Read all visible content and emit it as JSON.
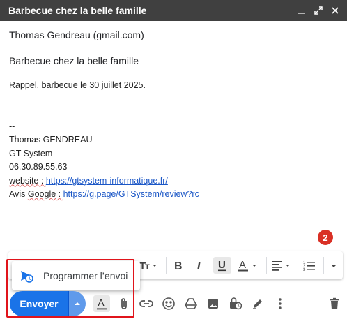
{
  "window": {
    "title": "Barbecue chez la belle famille",
    "controls": [
      "minimize-icon",
      "expand-icon",
      "close-icon"
    ]
  },
  "compose": {
    "to": "Thomas Gendreau (gmail.com)",
    "subject": "Barbecue chez la belle famille",
    "body": {
      "line1": "Rappel, barbecue le 30 juillet 2025.",
      "sig_dash": "--",
      "sig_name": "Thomas GENDREAU",
      "sig_company": "GT System",
      "sig_phone": "06.30.89.55.63",
      "website_label": "website",
      "website_colon": " : ",
      "website_url": "https://gtsystem-informatique.fr/",
      "avis_prefix": "Avis ",
      "google_label": "Google",
      "avis_colon": " : ",
      "review_url": "https://g.page/GTSystem/review?rc"
    }
  },
  "annotation": {
    "badge": "2",
    "highlight_color": "#e0141b"
  },
  "schedule_menu": {
    "label": "Programmer l’envoi",
    "icon": "schedule-send-icon"
  },
  "send": {
    "label": "Envoyer",
    "color": "#1a73e8"
  },
  "format_toolbar": [
    "text-size-icon",
    "bold-icon",
    "italic-icon",
    "underline-icon",
    "text-color-icon",
    "align-icon",
    "list-icon",
    "more-formatting-icon"
  ],
  "bottom_toolbar": [
    "formatting-toggle-icon",
    "attach-icon",
    "link-icon",
    "emoji-icon",
    "drive-icon",
    "photo-icon",
    "confidential-icon",
    "signature-icon",
    "more-options-icon",
    "delete-icon"
  ]
}
